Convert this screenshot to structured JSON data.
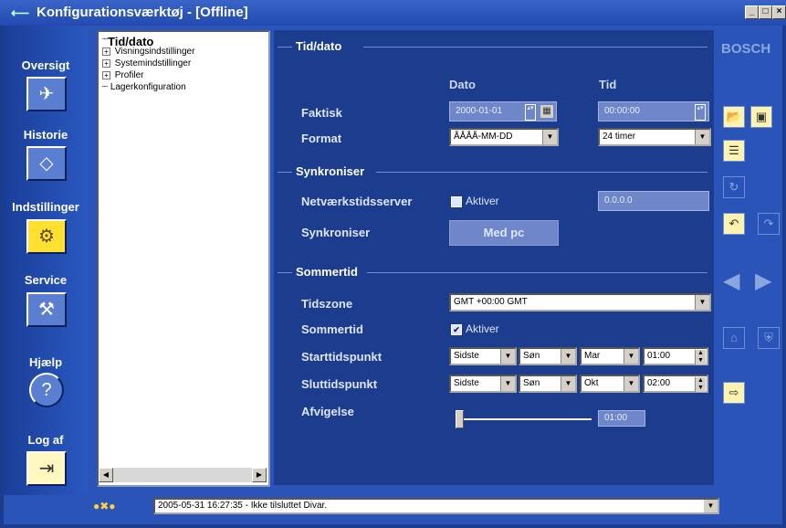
{
  "window": {
    "title": "Konfigurationsværktøj - [Offline]",
    "controls": [
      "_",
      "□",
      "×"
    ]
  },
  "leftnav": {
    "items": [
      {
        "label": "Oversigt",
        "icon": "overview-icon"
      },
      {
        "label": "Historie",
        "icon": "history-icon"
      },
      {
        "label": "Indstillinger",
        "icon": "settings-gears-icon"
      },
      {
        "label": "Service",
        "icon": "service-icon"
      },
      {
        "label": "Hjælp",
        "icon": "help-icon"
      },
      {
        "label": "Log af",
        "icon": "logout-icon"
      }
    ],
    "active_index": 2
  },
  "tree": {
    "items": [
      {
        "label": "Tid/dato",
        "expander": "",
        "selected": true
      },
      {
        "label": "Visningsindstillinger",
        "expander": "+"
      },
      {
        "label": "Systemindstillinger",
        "expander": "+"
      },
      {
        "label": "Profiler",
        "expander": "+"
      },
      {
        "label": "Lagerkonfiguration",
        "expander": ""
      }
    ]
  },
  "main": {
    "section_time": "Tid/dato",
    "col_date": "Dato",
    "col_time": "Tid",
    "label_actual": "Faktisk",
    "actual_date": "2000-01-01",
    "actual_time": "00:00:00",
    "label_format": "Format",
    "date_format": "ÅÅÅÅ-MM-DD",
    "time_format": "24 timer",
    "section_sync": "Synkroniser",
    "label_ntp": "Netværkstidsserver",
    "ntp_enable_label": "Aktiver",
    "ntp_enabled": false,
    "ntp_address": "0.0.0.0",
    "label_sync": "Synkroniser",
    "sync_button": "Med pc",
    "section_dst": "Sommertid",
    "label_timezone": "Tidszone",
    "timezone": "GMT +00:00 GMT",
    "label_dst": "Sommertid",
    "dst_enable_label": "Aktiver",
    "dst_enabled": true,
    "label_start": "Starttidspunkt",
    "start": {
      "week": "Sidste",
      "day": "Søn",
      "month": "Mar",
      "time": "01:00"
    },
    "label_end": "Sluttidspunkt",
    "end": {
      "week": "Sidste",
      "day": "Søn",
      "month": "Okt",
      "time": "02:00"
    },
    "label_offset": "Afvigelse",
    "offset_value": "01:00"
  },
  "rightbar": {
    "brand": "BOSCH",
    "buttons": [
      "open-folder-icon",
      "save-disk-icon",
      "tree-list-icon",
      "refresh-icon",
      "undo-icon",
      "redo-icon",
      "back-arrow-icon",
      "forward-arrow-icon",
      "camera-icon",
      "shield-icon",
      "export-icon"
    ]
  },
  "status": {
    "text": "2005-05-31 16:27:35 - Ikke tilsluttet Divar."
  },
  "colors": {
    "background": "#1c3c8e",
    "panel": "#2a54b8",
    "active_nav": "#ffe030"
  }
}
